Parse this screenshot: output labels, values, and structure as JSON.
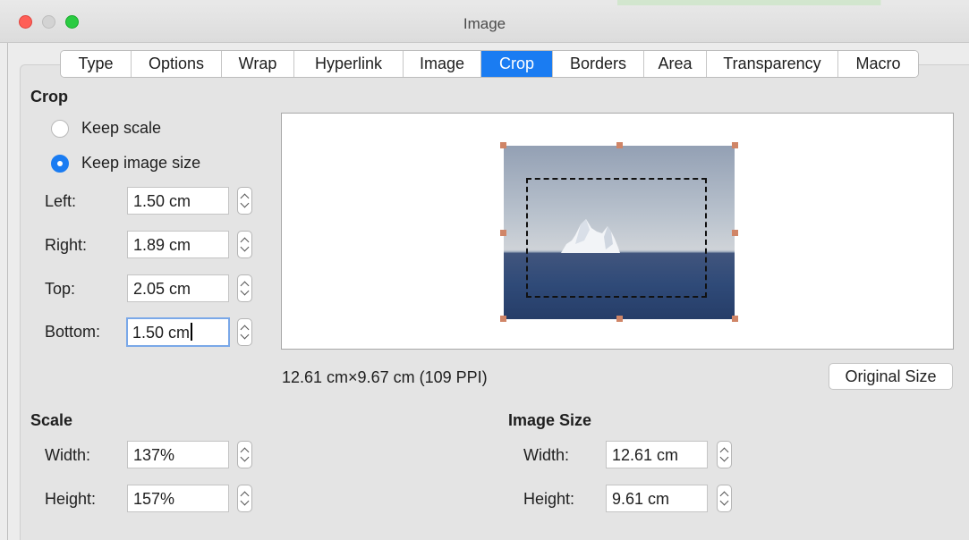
{
  "window": {
    "title": "Image"
  },
  "tabs": [
    {
      "label": "Type",
      "active": false
    },
    {
      "label": "Options",
      "active": false
    },
    {
      "label": "Wrap",
      "active": false
    },
    {
      "label": "Hyperlink",
      "active": false
    },
    {
      "label": "Image",
      "active": false
    },
    {
      "label": "Crop",
      "active": true
    },
    {
      "label": "Borders",
      "active": false
    },
    {
      "label": "Area",
      "active": false
    },
    {
      "label": "Transparency",
      "active": false
    },
    {
      "label": "Macro",
      "active": false
    }
  ],
  "crop": {
    "heading": "Crop",
    "keep_scale_label": "Keep scale",
    "keep_image_size_label": "Keep image size",
    "selected_mode": "keep_image_size",
    "left_label": "Left:",
    "left_value": "1.50 cm",
    "right_label": "Right:",
    "right_value": "1.89 cm",
    "top_label": "Top:",
    "top_value": "2.05 cm",
    "bottom_label": "Bottom:",
    "bottom_value": "1.50 cm"
  },
  "preview": {
    "size_info": "12.61 cm×9.67 cm (109 PPI)",
    "original_size_label": "Original Size"
  },
  "scale": {
    "heading": "Scale",
    "width_label": "Width:",
    "width_value": "137%",
    "height_label": "Height:",
    "height_value": "157%"
  },
  "image_size": {
    "heading": "Image Size",
    "width_label": "Width:",
    "width_value": "12.61 cm",
    "height_label": "Height:",
    "height_value": "9.61 cm"
  },
  "colors": {
    "accent": "#1a7cf2",
    "handle": "#d08567"
  }
}
